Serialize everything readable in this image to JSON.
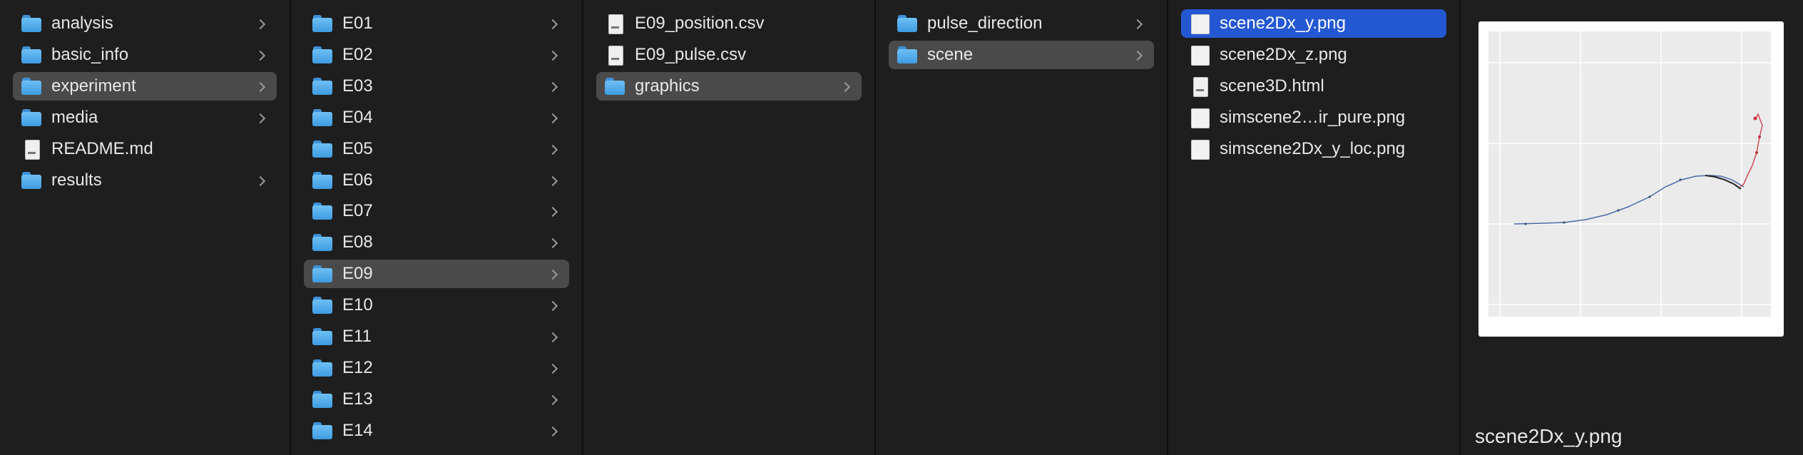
{
  "columns": [
    {
      "items": [
        {
          "label": "analysis",
          "type": "folder"
        },
        {
          "label": "basic_info",
          "type": "folder"
        },
        {
          "label": "experiment",
          "type": "folder",
          "state": "path"
        },
        {
          "label": "media",
          "type": "folder"
        },
        {
          "label": "README.md",
          "type": "doc"
        },
        {
          "label": "results",
          "type": "folder"
        }
      ]
    },
    {
      "items": [
        {
          "label": "E01",
          "type": "folder"
        },
        {
          "label": "E02",
          "type": "folder"
        },
        {
          "label": "E03",
          "type": "folder"
        },
        {
          "label": "E04",
          "type": "folder"
        },
        {
          "label": "E05",
          "type": "folder"
        },
        {
          "label": "E06",
          "type": "folder"
        },
        {
          "label": "E07",
          "type": "folder"
        },
        {
          "label": "E08",
          "type": "folder"
        },
        {
          "label": "E09",
          "type": "folder",
          "state": "path"
        },
        {
          "label": "E10",
          "type": "folder"
        },
        {
          "label": "E11",
          "type": "folder"
        },
        {
          "label": "E12",
          "type": "folder"
        },
        {
          "label": "E13",
          "type": "folder"
        },
        {
          "label": "E14",
          "type": "folder"
        }
      ]
    },
    {
      "items": [
        {
          "label": "E09_position.csv",
          "type": "doc"
        },
        {
          "label": "E09_pulse.csv",
          "type": "doc"
        },
        {
          "label": "graphics",
          "type": "folder",
          "state": "path"
        }
      ]
    },
    {
      "items": [
        {
          "label": "pulse_direction",
          "type": "folder"
        },
        {
          "label": "scene",
          "type": "folder",
          "state": "path"
        }
      ]
    },
    {
      "items": [
        {
          "label": "scene2Dx_y.png",
          "type": "image",
          "state": "selected"
        },
        {
          "label": "scene2Dx_z.png",
          "type": "image"
        },
        {
          "label": "scene3D.html",
          "type": "doc"
        },
        {
          "label": "simscene2…ir_pure.png",
          "type": "image"
        },
        {
          "label": "simscene2Dx_y_loc.png",
          "type": "image"
        }
      ]
    }
  ],
  "preview": {
    "filename": "scene2Dx_y.png"
  },
  "colors": {
    "selection": "#2458d3",
    "path_highlight": "#4a4a4a",
    "folder": "#4fa8ea",
    "background": "#1e1e1e"
  }
}
